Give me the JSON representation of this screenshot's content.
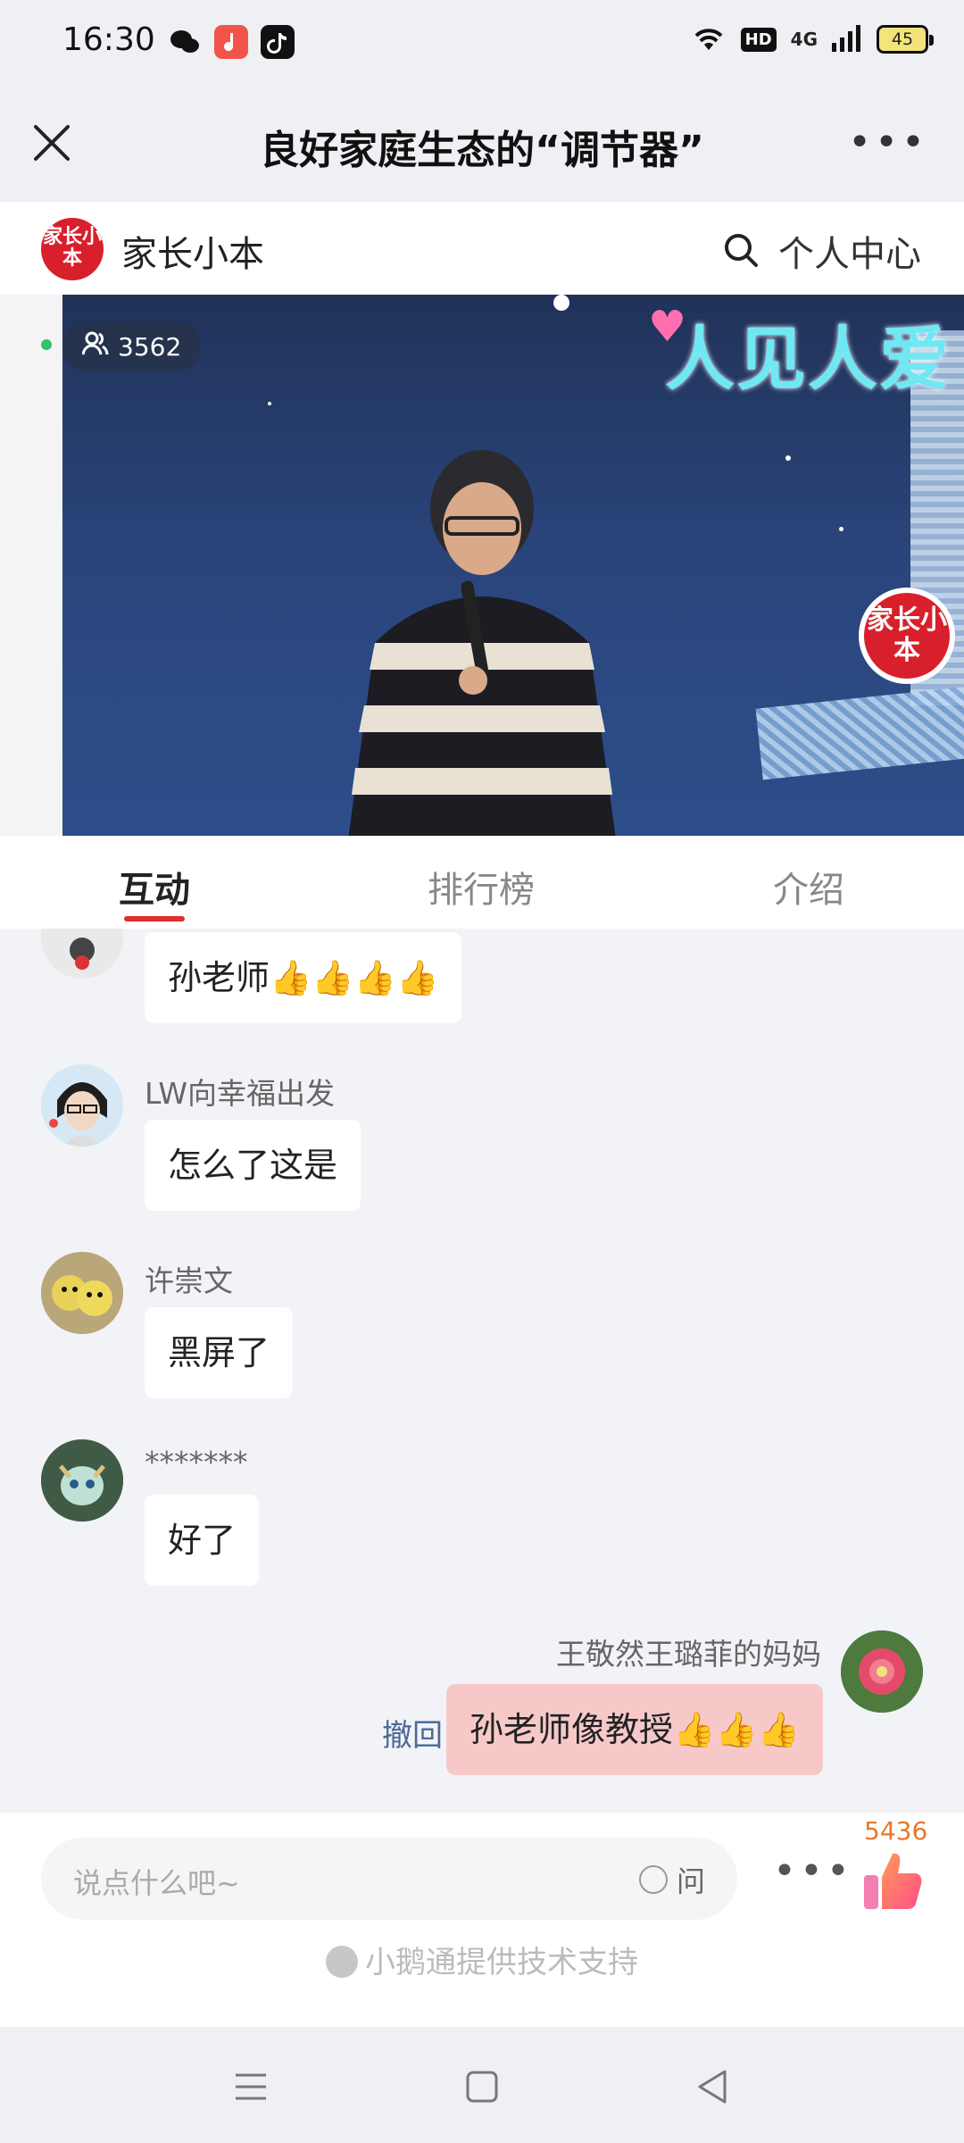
{
  "status_bar": {
    "time": "16:30",
    "hd": "HD",
    "network": "4G",
    "battery": "45"
  },
  "title_bar": {
    "title": "良好家庭生态的“调节器”"
  },
  "shop_header": {
    "logo_text": "家长小本",
    "name": "家长小本",
    "personal_center": "个人中心"
  },
  "video": {
    "viewer_count": "3562",
    "banner_text": "人见人爱",
    "watermark_text": "家长小本"
  },
  "tabs": [
    {
      "label": "互动",
      "active": true
    },
    {
      "label": "排行榜",
      "active": false
    },
    {
      "label": "介绍",
      "active": false
    }
  ],
  "messages": [
    {
      "user": "",
      "text": "孙老师👍👍👍👍",
      "mine": false
    },
    {
      "user": "LW向幸福出发",
      "text": "怎么了这是",
      "mine": false
    },
    {
      "user": "许崇文",
      "text": "黑屏了",
      "mine": false
    },
    {
      "user": "*******",
      "text": "好了",
      "mine": false
    },
    {
      "user": "王敬然王璐菲的妈妈",
      "text": "孙老师像教授👍👍👍",
      "mine": true,
      "recall": "撤回"
    }
  ],
  "input_bar": {
    "placeholder": "说点什么吧~",
    "ask_label": "问",
    "like_count": "5436",
    "support_text": "小鹅通提供技术支持"
  },
  "colors": {
    "accent_red": "#e02d2d",
    "like_orange": "#e8772e",
    "mine_bubble": "#f6c9c8"
  }
}
